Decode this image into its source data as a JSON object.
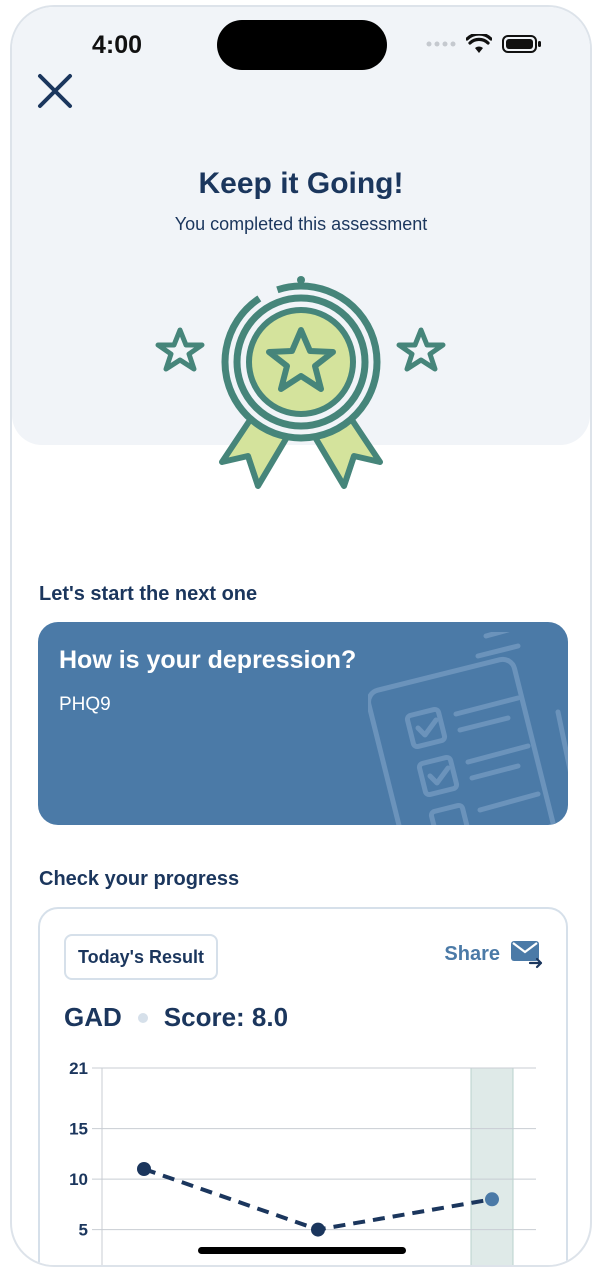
{
  "status_bar": {
    "time": "4:00"
  },
  "close_icon": "close-icon",
  "hero": {
    "title": "Keep it Going!",
    "subtitle": "You completed this assessment",
    "badge_icon": "award-medal-icon"
  },
  "next": {
    "section_title": "Let's start the next one",
    "card_title": "How is your depression?",
    "card_code": "PHQ9",
    "card_icon": "checklist-icon"
  },
  "progress": {
    "section_title": "Check your progress",
    "result_tag": "Today's Result",
    "share_label": "Share",
    "share_icon": "mail-forward-icon",
    "measure": "GAD",
    "score_text": "Score: 8.0"
  },
  "colors": {
    "navy": "#1b365d",
    "accent": "#4b7aa7",
    "badge_green": "#46857a",
    "badge_fill": "#d4e39c",
    "highlight": "#dfeae8"
  },
  "chart_data": {
    "type": "line",
    "y_ticks": [
      21,
      15,
      10,
      5
    ],
    "ylim": [
      0,
      21
    ],
    "x": [
      1,
      2,
      3
    ],
    "series": [
      {
        "values": [
          11,
          5,
          8
        ]
      }
    ],
    "highlight_index": 2,
    "grid": true
  }
}
